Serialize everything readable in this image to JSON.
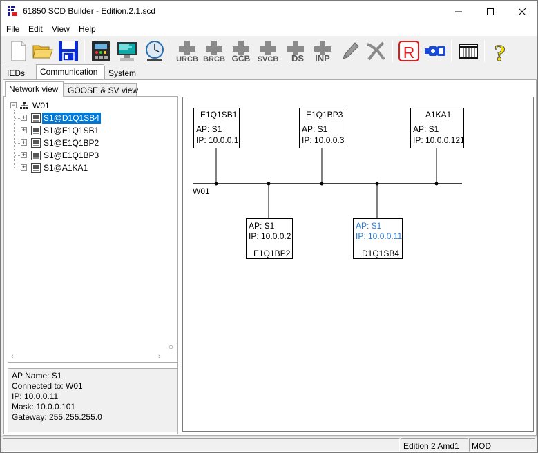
{
  "window": {
    "title": "61850 SCD Builder - Edition.2.1.scd",
    "controls": {
      "minimize": "minimize-icon",
      "maximize": "maximize-icon",
      "close": "close-icon"
    }
  },
  "menu": {
    "items": [
      "File",
      "Edit",
      "View",
      "Help"
    ]
  },
  "toolbar": {
    "buttons": [
      {
        "icon": "new-file-icon"
      },
      {
        "icon": "open-folder-icon"
      },
      {
        "icon": "save-icon"
      },
      {
        "icon": "device-icon"
      },
      {
        "icon": "monitor-icon"
      },
      {
        "icon": "clock-icon"
      },
      {
        "icon": "add-urcb-icon",
        "label": "URCB"
      },
      {
        "icon": "add-brcb-icon",
        "label": "BRCB"
      },
      {
        "icon": "add-gcb-icon",
        "label": "GCB"
      },
      {
        "icon": "add-svcb-icon",
        "label": "SVCB"
      },
      {
        "icon": "add-ds-icon",
        "label": "DS"
      },
      {
        "icon": "add-inp-icon",
        "label": "INP"
      },
      {
        "icon": "edit-pencil-icon"
      },
      {
        "icon": "delete-icon"
      },
      {
        "icon": "r-icon",
        "label": "R"
      },
      {
        "icon": "connector-icon"
      },
      {
        "icon": "table-icon"
      },
      {
        "icon": "help-icon",
        "label": "?"
      }
    ],
    "accent": {
      "save": "#0a2bd8",
      "r": "#e01b1b",
      "help": "#f2e100"
    }
  },
  "tabs": {
    "main": [
      {
        "label": "IEDs",
        "active": false
      },
      {
        "label": "Communication",
        "active": true
      },
      {
        "label": "System",
        "active": false
      }
    ],
    "sub": [
      {
        "label": "Network view",
        "active": true
      },
      {
        "label": "GOOSE & SV view",
        "active": false
      }
    ]
  },
  "tree": {
    "root": "W01",
    "items": [
      {
        "label": "S1@D1Q1SB4",
        "selected": true
      },
      {
        "label": "S1@E1Q1SB1",
        "selected": false
      },
      {
        "label": "S1@E1Q1BP2",
        "selected": false
      },
      {
        "label": "S1@E1Q1BP3",
        "selected": false
      },
      {
        "label": "S1@A1KA1",
        "selected": false
      }
    ]
  },
  "info": {
    "ap_name": "AP Name: S1",
    "connected_to": "Connected to: W01",
    "ip": "IP: 10.0.0.11",
    "mask": "Mask: 10.0.0.101",
    "gateway": "Gateway: 255.255.255.0"
  },
  "network": {
    "bus_label": "W01",
    "ieds_top": [
      {
        "name": "E1Q1SB1",
        "ap": "AP: S1",
        "ip": "IP: 10.0.0.1",
        "highlight": false
      },
      {
        "name": "E1Q1BP3",
        "ap": "AP: S1",
        "ip": "IP: 10.0.0.3",
        "highlight": false
      },
      {
        "name": "A1KA1",
        "ap": "AP: S1",
        "ip": "IP: 10.0.0.121",
        "highlight": false
      }
    ],
    "ieds_bottom": [
      {
        "name": "E1Q1BP2",
        "ap": "AP: S1",
        "ip": "IP: 10.0.0.2",
        "highlight": false
      },
      {
        "name": "D1Q1SB4",
        "ap": "AP: S1",
        "ip": "IP: 10.0.0.11",
        "highlight": true
      }
    ],
    "highlight_color": "#2a7ed3"
  },
  "status": {
    "edition": "Edition 2 Amd1",
    "mode": "MOD"
  }
}
